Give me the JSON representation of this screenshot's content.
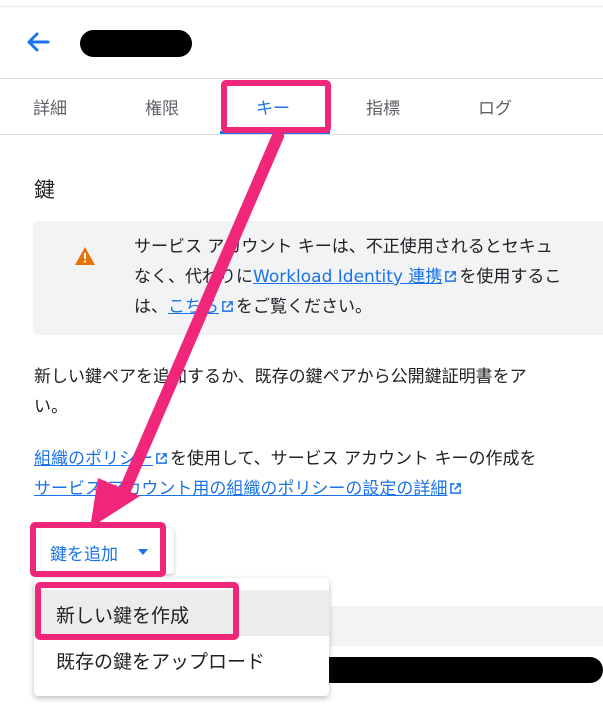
{
  "header": {
    "back_icon": "arrow-left-icon",
    "title_redacted": true
  },
  "tabs": [
    {
      "label": "詳細"
    },
    {
      "label": "権限"
    },
    {
      "label": "キー"
    },
    {
      "label": "指標"
    },
    {
      "label": "ログ"
    }
  ],
  "active_tab": "キー",
  "section": {
    "title": "鍵"
  },
  "info_box": {
    "icon": "warning-icon",
    "line1": "サービス アカウント キーは、不正使用されるとセキュ",
    "line2_pre": "なく、代わりに",
    "line2_link": "Workload Identity 連携",
    "line2_post": "を使用するこ",
    "line3_pre": "は、",
    "line3_link": "こちら",
    "line3_post": "をご覧ください。"
  },
  "description": {
    "line1": "新しい鍵ペアを追加するか、既存の鍵ペアから公開鍵証明書をア",
    "line2": "い。"
  },
  "policy": {
    "link1": "組織のポリシー",
    "text1": "を使用して、サービス アカウント キーの作成を",
    "link2": "サービス アカウント用の組織のポリシーの設定の詳細"
  },
  "add_key_button": {
    "label": "鍵を追加"
  },
  "menu": {
    "items": [
      {
        "label": "新しい鍵を作成"
      },
      {
        "label": "既存の鍵をアップロード"
      }
    ]
  },
  "colors": {
    "accent": "#1a73e8",
    "highlight": "#f0267a",
    "warning": "#e8710a"
  }
}
